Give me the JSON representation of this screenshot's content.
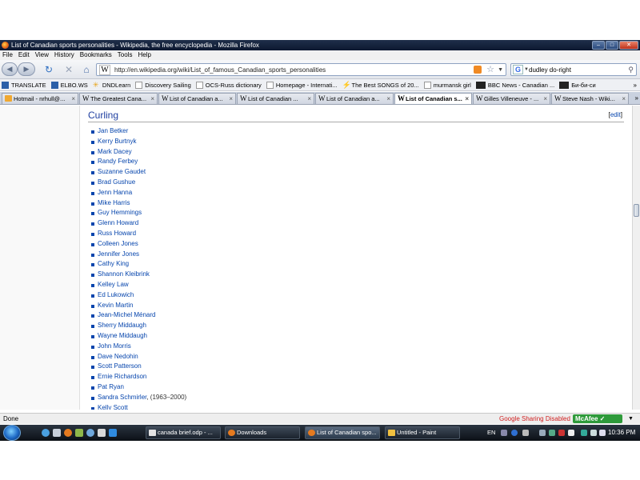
{
  "window": {
    "title": "List of Canadian sports personalities - Wikipedia, the free encyclopedia - Mozilla Firefox"
  },
  "menu": [
    "File",
    "Edit",
    "View",
    "History",
    "Bookmarks",
    "Tools",
    "Help"
  ],
  "address": {
    "url": "http://en.wikipedia.org/wiki/List_of_famous_Canadian_sports_personalities",
    "site_icon": "W"
  },
  "search": {
    "engine_icon": "G",
    "value": "dudley do-right"
  },
  "bookmarks": [
    {
      "label": "TRANSLATE",
      "icon": "translate-icon"
    },
    {
      "label": "ELBO.WS",
      "icon": "page-icon"
    },
    {
      "label": "DNDLearn",
      "icon": "star-icon"
    },
    {
      "label": "Discovery Sailing",
      "icon": "page-icon"
    },
    {
      "label": "OCS-Russ dictionary",
      "icon": "page-icon"
    },
    {
      "label": "Homepage - Internati...",
      "icon": "page-icon"
    },
    {
      "label": "The Best SONGS of 20...",
      "icon": "bolt-icon"
    },
    {
      "label": "murmansk girl",
      "icon": "page-icon"
    },
    {
      "label": "BBC News - Canadian ...",
      "icon": "bbc-icon"
    },
    {
      "label": "Би-би-си",
      "icon": "bbc-icon"
    }
  ],
  "bookmarks_more": "»",
  "tabs": [
    {
      "label": "Hotmail - nrhull@...",
      "icon": "hotmail",
      "active": false
    },
    {
      "label": "The Greatest Cana...",
      "icon": "W",
      "active": false
    },
    {
      "label": "List of Canadian a...",
      "icon": "W",
      "active": false
    },
    {
      "label": "List of Canadian ...",
      "icon": "W",
      "active": false
    },
    {
      "label": "List of Canadian a...",
      "icon": "W",
      "active": false
    },
    {
      "label": "List of Canadian s...",
      "icon": "W",
      "active": true
    },
    {
      "label": "Gilles Villeneuve - ...",
      "icon": "W",
      "active": false
    },
    {
      "label": "Steve Nash - Wiki...",
      "icon": "W",
      "active": false
    }
  ],
  "tab_close": "×",
  "tabs_more": "»",
  "section": {
    "heading": "Curling",
    "edit_open": "[",
    "edit_label": "edit",
    "edit_close": "]"
  },
  "people": [
    {
      "name": "Jan Betker"
    },
    {
      "name": "Kerry Burtnyk"
    },
    {
      "name": "Mark Dacey"
    },
    {
      "name": "Randy Ferbey"
    },
    {
      "name": "Suzanne Gaudet"
    },
    {
      "name": "Brad Gushue"
    },
    {
      "name": "Jenn Hanna"
    },
    {
      "name": "Mike Harris"
    },
    {
      "name": "Guy Hemmings"
    },
    {
      "name": "Glenn Howard"
    },
    {
      "name": "Russ Howard"
    },
    {
      "name": "Colleen Jones"
    },
    {
      "name": "Jennifer Jones"
    },
    {
      "name": "Cathy King"
    },
    {
      "name": "Shannon Kleibrink"
    },
    {
      "name": "Kelley Law"
    },
    {
      "name": "Ed Lukowich"
    },
    {
      "name": "Kevin Martin"
    },
    {
      "name": "Jean-Michel Ménard"
    },
    {
      "name": "Sherry Middaugh"
    },
    {
      "name": "Wayne Middaugh"
    },
    {
      "name": "John Morris"
    },
    {
      "name": "Dave Nedohin"
    },
    {
      "name": "Scott Patterson"
    },
    {
      "name": "Ernie Richardson"
    },
    {
      "name": "Pat Ryan"
    },
    {
      "name": "Sandra Schmirler",
      "extra": ", (1963–2000)"
    },
    {
      "name": "Kelly Scott"
    }
  ],
  "status": {
    "text": "Done",
    "google_sharing": "Google Sharing Disabled",
    "mcafee": "McAfee"
  },
  "taskbar": {
    "tasks": [
      {
        "label": "canada brief.odp - ...",
        "active": false
      },
      {
        "label": "Downloads",
        "active": false
      },
      {
        "label": "List of Canadian spo...",
        "active": true
      },
      {
        "label": "Untitled - Paint",
        "active": false
      }
    ],
    "language": "EN",
    "clock": "10:36 PM"
  },
  "colors": {
    "link": "#0645ad",
    "heading": "#1f3fa0",
    "google_sharing": "#d02020",
    "mcafee": "#2e9a3a"
  }
}
